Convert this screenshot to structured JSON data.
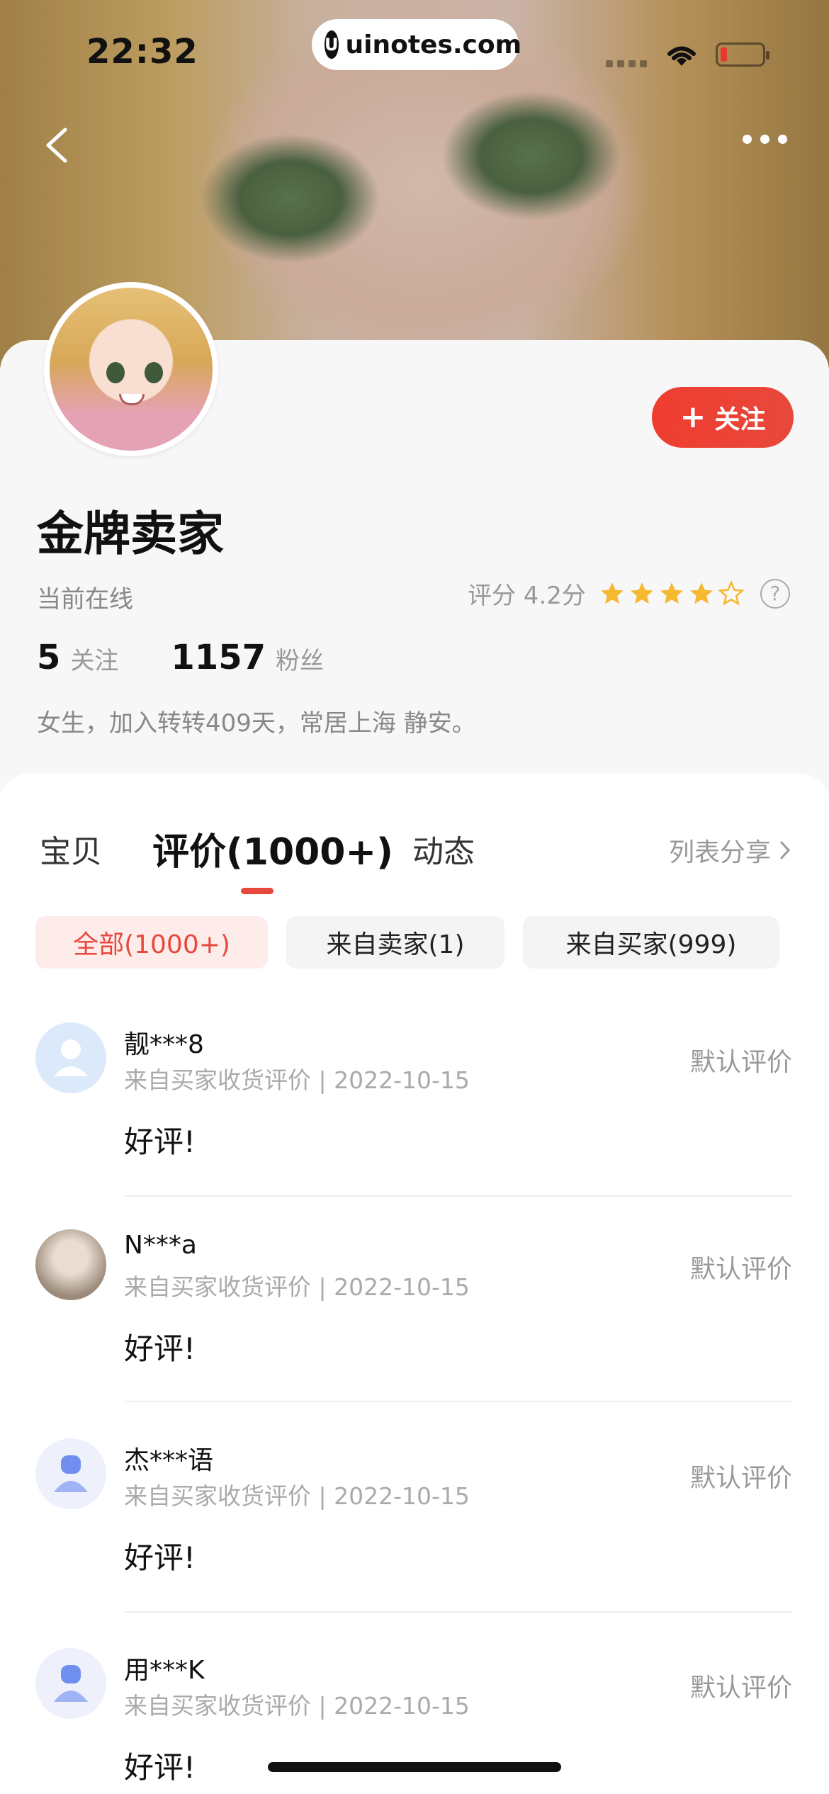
{
  "status_bar": {
    "time": "22:32",
    "url": "uinotes.com"
  },
  "profile": {
    "name": "金牌卖家",
    "online_status": "当前在线",
    "rating_label": "评分 4.2分",
    "rating_value": 4.2,
    "rating_stars": 4,
    "follow_button": "关注",
    "following_count": "5",
    "following_label": "关注",
    "fans_count": "1157",
    "fans_label": "粉丝",
    "bio": "女生，加入转转409天，常居上海 静安。"
  },
  "tabs": [
    {
      "label": "宝贝",
      "active": false
    },
    {
      "label": "评价(1000+)",
      "active": true
    },
    {
      "label": "动态",
      "active": false
    }
  ],
  "share_label": "列表分享",
  "filter_chips": [
    {
      "label": "全部(1000+)",
      "active": true
    },
    {
      "label": "来自卖家(1)",
      "active": false
    },
    {
      "label": "来自买家(999)",
      "active": false
    }
  ],
  "reviews": [
    {
      "user": "靓***8",
      "meta": "来自买家收货评价 | 2022-10-15",
      "text": "好评!",
      "tag": "默认评价",
      "avatar": "default-user-icon"
    },
    {
      "user": "N***a",
      "meta": "来自买家收货评价 | 2022-10-15",
      "text": "好评!",
      "tag": "默认评价",
      "avatar": "photo-avatar"
    },
    {
      "user": "杰***语",
      "meta": "来自买家收货评价 | 2022-10-15",
      "text": "好评!",
      "tag": "默认评价",
      "avatar": "default-user-icon"
    },
    {
      "user": "用***K",
      "meta": "来自买家收货评价 | 2022-10-15",
      "text": "好评!",
      "tag": "默认评价",
      "avatar": "default-user-icon"
    }
  ],
  "colors": {
    "accent": "#e8483c",
    "star": "#f5b82e"
  }
}
